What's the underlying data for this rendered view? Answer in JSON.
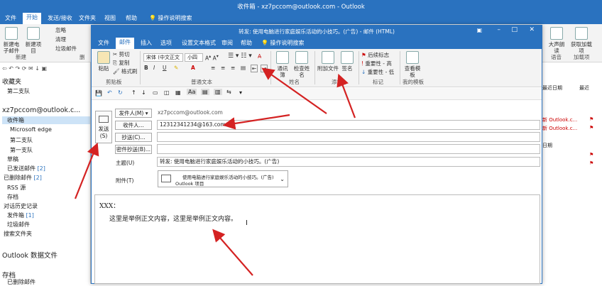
{
  "outlook": {
    "title": "收件箱 - xz7pccom@outlook.com - Outlook",
    "tabs": [
      "文件",
      "开始",
      "发送/接收",
      "文件夹",
      "视图",
      "帮助"
    ],
    "tell_me": "操作说明搜索",
    "ribbon": {
      "new_email": "新建电子邮件",
      "new_items": "新建项目",
      "ignore": "忽略",
      "cleanup": "清理",
      "junk": "垃圾邮件",
      "group_new": "新建",
      "group_delete": "删",
      "big_text": "大声朗读",
      "get_addins": "获取加载项",
      "group_speech": "语音",
      "group_addin": "加载项"
    },
    "sidebar": {
      "favorites": "收藏夹",
      "fav_item": "第二支队",
      "account": "xz7pccom@outlook.c...",
      "inbox": "收件箱",
      "items": [
        {
          "label": "Microsoft edge",
          "badge": ""
        },
        {
          "label": "第二支队",
          "badge": ""
        },
        {
          "label": "第一支队",
          "badge": ""
        },
        {
          "label": "草稿",
          "badge": ""
        },
        {
          "label": "已发送邮件",
          "badge": "[2]"
        },
        {
          "label": "已删除邮件",
          "badge": "[2]"
        },
        {
          "label": "RSS 源",
          "badge": ""
        },
        {
          "label": "存档",
          "badge": ""
        },
        {
          "label": "对话历史记录",
          "badge": ""
        },
        {
          "label": "发件箱",
          "badge": "[1]"
        },
        {
          "label": "垃圾邮件",
          "badge": ""
        },
        {
          "label": "搜索文件夹",
          "badge": ""
        }
      ],
      "data_file": "Outlook 数据文件",
      "archive": "存档",
      "deleted": "已删除邮件"
    },
    "right_pane": {
      "header": "最近日期",
      "filter": "最近",
      "rows": [
        "新 Outlook.c...",
        "新 Outlook.c..."
      ],
      "month": "日期"
    }
  },
  "compose": {
    "title": "转发: 使用电脑进行家庭娱乐活动的小技巧。(广告) - 邮件 (HTML)",
    "tabs": [
      "文件",
      "邮件",
      "插入",
      "选项",
      "设置文本格式",
      "审阅",
      "帮助"
    ],
    "tell_me": "操作说明搜索",
    "ribbon": {
      "paste": "粘贴",
      "cut": "剪切",
      "copy": "复制",
      "format_painter": "格式刷",
      "group_clipboard": "剪贴板",
      "font_name": "宋体 (中文正文",
      "font_size": "小四",
      "group_basic_text": "普通文本",
      "address_book": "通讯簿",
      "check_names": "检查姓名",
      "group_names": "姓名",
      "attach_file": "附加文件",
      "signature": "签名",
      "group_include": "添加",
      "follow_up": "后续标志",
      "high_importance": "重要性 - 高",
      "low_importance": "重要性 - 低",
      "group_tags": "标记",
      "view_template": "查看模板",
      "group_templates": "我的模板"
    },
    "send_button": "发送(S)",
    "from_button": "发件人(M)",
    "from_value": "xz7pccom@outlook.com",
    "to_button": "收件人...",
    "to_value": "12312341234@163.com",
    "cc_button": "抄送(C)...",
    "bcc_button": "密件抄送(B)...",
    "subject_label": "主题(U)",
    "subject_value": "转发:     使用电脑进行家庭娱乐活动的小技巧。(广告)",
    "attachment_label": "附件(T)",
    "attachment_name": "使用电脑进行家庭娱乐活动的小技巧。(广告)",
    "attachment_type": "Outlook 项目",
    "body_greeting": "XXX：",
    "body_text": "这里是举例正文内容，这里是举例正文内容。"
  }
}
